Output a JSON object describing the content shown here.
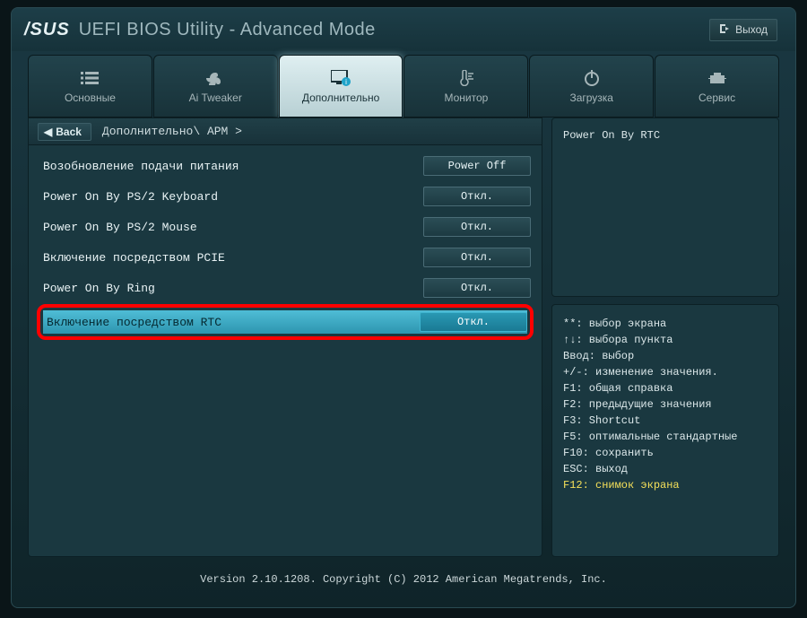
{
  "title": {
    "brand": "/SUS",
    "text": "UEFI BIOS Utility - Advanced Mode"
  },
  "exit_label": "Выход",
  "tabs": [
    {
      "label": "Основные"
    },
    {
      "label": "Ai Tweaker"
    },
    {
      "label": "Дополнительно"
    },
    {
      "label": "Монитор"
    },
    {
      "label": "Загрузка"
    },
    {
      "label": "Сервис"
    }
  ],
  "back_label": "Back",
  "breadcrumb": "Дополнительно\\ APM >",
  "settings": [
    {
      "label": "Возобновление подачи питания",
      "value": "Power Off"
    },
    {
      "label": "Power On By PS/2 Keyboard",
      "value": "Откл."
    },
    {
      "label": "Power On By PS/2 Mouse",
      "value": "Откл."
    },
    {
      "label": "Включение посредством PCIE",
      "value": "Откл."
    },
    {
      "label": "Power On By Ring",
      "value": "Откл."
    },
    {
      "label": "Включение посредством RTC",
      "value": "Откл."
    }
  ],
  "info_text": "Power On By RTC",
  "help": [
    "**: выбор экрана",
    "↑↓: выбора пункта",
    "Ввод: выбор",
    "+/-: изменение значения.",
    "F1: общая справка",
    "F2: предыдущие значения",
    "F3: Shortcut",
    "F5: оптимальные стандартные",
    "F10: сохранить",
    "ESC: выход"
  ],
  "help_yellow": "F12: снимок экрана",
  "footer": "Version 2.10.1208. Copyright (C) 2012 American Megatrends, Inc."
}
